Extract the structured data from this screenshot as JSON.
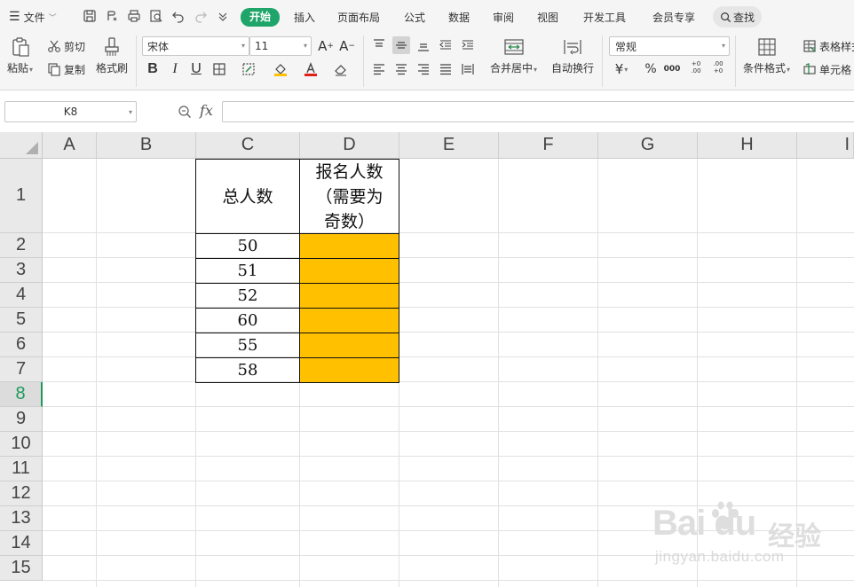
{
  "menubar": {
    "file_label": "文件",
    "tabs": [
      "开始",
      "插入",
      "页面布局",
      "公式",
      "数据",
      "审阅",
      "视图",
      "开发工具",
      "会员专享"
    ],
    "active_tab": "开始",
    "search_label": "查找",
    "accent_color": "#1fa56a"
  },
  "ribbon": {
    "paste_label": "粘贴",
    "cut_label": "剪切",
    "copy_label": "复制",
    "format_painter_label": "格式刷",
    "font_name": "宋体",
    "font_size": "11",
    "bold_glyph": "B",
    "italic_glyph": "I",
    "underline_glyph": "U",
    "merge_center_label": "合并居中",
    "wrap_text_label": "自动换行",
    "number_format": "常规",
    "currency_glyph": "¥",
    "percent_glyph": "%",
    "thousands_glyph": "000",
    "inc_decimal_glyph": "+0 .00",
    "dec_decimal_glyph": ".00 +0",
    "conditional_format_label": "条件格式",
    "table_style_label": "表格样式",
    "cell_style_label": "单元格"
  },
  "formula_bar": {
    "name_box": "K8",
    "fx_label": "fx",
    "formula_value": ""
  },
  "sheet": {
    "columns": [
      "A",
      "B",
      "C",
      "D",
      "E",
      "F",
      "G",
      "H",
      "I"
    ],
    "rows": [
      "1",
      "2",
      "3",
      "4",
      "5",
      "6",
      "7",
      "8",
      "9",
      "10",
      "11",
      "12",
      "13",
      "14",
      "15"
    ],
    "active_row": "8",
    "header_c1": "总人数",
    "header_d1_lines": [
      "报名人数",
      "（需要为",
      "奇数）"
    ],
    "c_values": [
      "50",
      "51",
      "52",
      "60",
      "55",
      "58"
    ],
    "d_fill_color": "#ffc000"
  },
  "watermark": {
    "logo": "Bai du",
    "logo_cn": "经验",
    "url": "jingyan.baidu.com"
  }
}
